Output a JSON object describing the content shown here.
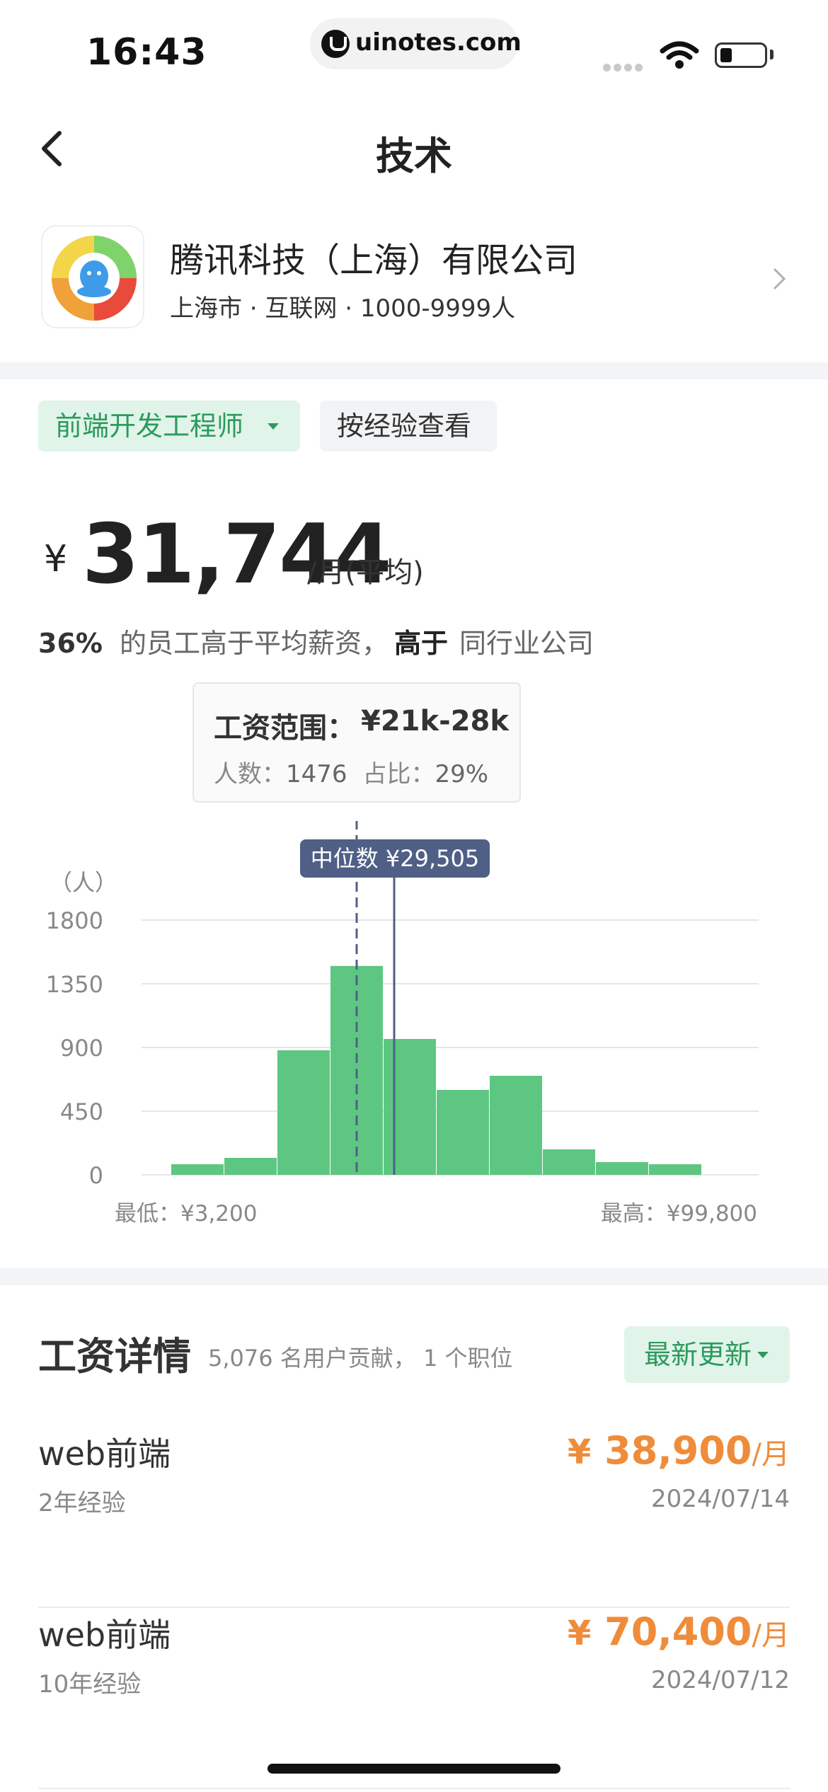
{
  "status_bar": {
    "time": "16:43",
    "url": "uinotes.com"
  },
  "nav": {
    "title": "技术"
  },
  "company": {
    "name": "腾讯科技（上海）有限公司",
    "meta": "上海市 · 互联网 · 1000-9999人"
  },
  "filters": {
    "job": "前端开发工程师",
    "experience": "按经验查看"
  },
  "salary": {
    "currency": "¥",
    "average": "31,744",
    "unit": "/月(平均)",
    "percent": "36%",
    "stat_text": "的员工高于平均薪资，",
    "higher_label": "高于",
    "peer_text": "同行业公司"
  },
  "tooltip": {
    "range_label": "工资范围：",
    "range_value": "¥21k-28k",
    "count_label": "人数：",
    "count_value": "1476",
    "share_label": "占比：",
    "share_value": "29%"
  },
  "chart_data": {
    "type": "bar",
    "title": "",
    "ylabel": "（人）",
    "ylim": [
      0,
      1800
    ],
    "yticks": [
      "1800",
      "1350",
      "900",
      "450",
      "0"
    ],
    "ytick_values": [
      1800,
      1350,
      900,
      450,
      0
    ],
    "values": [
      75,
      120,
      880,
      1476,
      960,
      600,
      700,
      180,
      90,
      75
    ],
    "bar_color": "#5dc782",
    "min_label": "最低：¥3,200",
    "max_label": "最高：¥99,800",
    "median_label": "中位数 ¥29,505",
    "median_index": 4.2,
    "highlight_index": 3.5
  },
  "details": {
    "title": "工资详情",
    "meta": "5,076 名用户贡献， 1 个职位",
    "sort": "最新更新",
    "entries": [
      {
        "title": "web前端",
        "experience": "2年经验",
        "currency": "¥",
        "amount": "38,900",
        "unit": "/月",
        "date": "2024/07/14"
      },
      {
        "title": "web前端",
        "experience": "10年经验",
        "currency": "¥",
        "amount": "70,400",
        "unit": "/月",
        "date": "2024/07/12"
      }
    ]
  },
  "colors": {
    "green": "#2c9a5c",
    "green_bg": "#e1f4ea",
    "orange": "#ef8c3a",
    "median_bg": "#4f5f86"
  }
}
